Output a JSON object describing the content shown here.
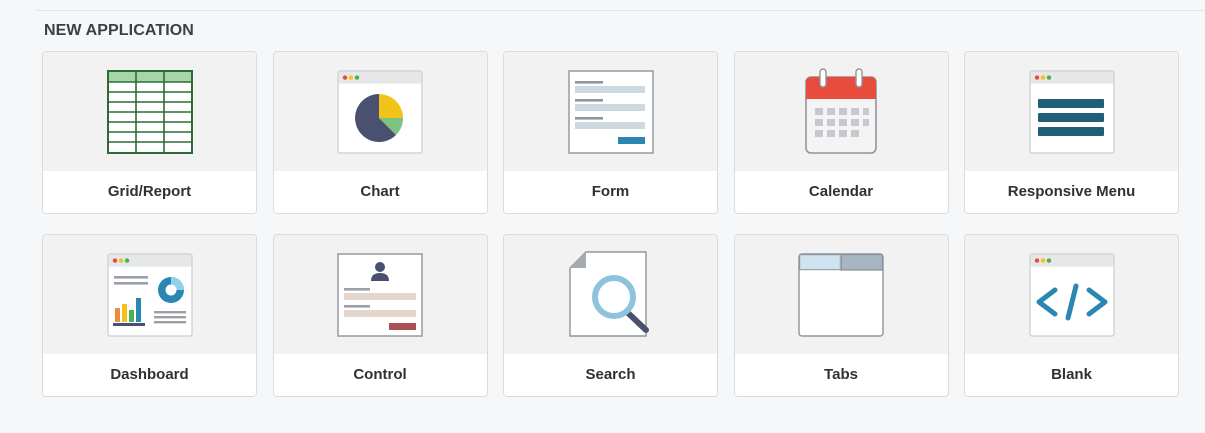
{
  "section": {
    "title": "NEW APPLICATION"
  },
  "cards": [
    {
      "label": "Grid/Report",
      "icon": "grid-report-icon"
    },
    {
      "label": "Chart",
      "icon": "chart-icon"
    },
    {
      "label": "Form",
      "icon": "form-icon"
    },
    {
      "label": "Calendar",
      "icon": "calendar-icon"
    },
    {
      "label": "Responsive Menu",
      "icon": "responsive-menu-icon"
    },
    {
      "label": "Dashboard",
      "icon": "dashboard-icon"
    },
    {
      "label": "Control",
      "icon": "control-icon"
    },
    {
      "label": "Search",
      "icon": "search-icon"
    },
    {
      "label": "Tabs",
      "icon": "tabs-icon"
    },
    {
      "label": "Blank",
      "icon": "blank-code-icon"
    }
  ],
  "colors": {
    "grid_green": "#2e7d32",
    "pie_navy": "#4a5170",
    "pie_yellow": "#f0c419",
    "pie_green": "#7bc47f",
    "calendar_red": "#e74c3c",
    "menu_teal": "#1f5f78",
    "accent_blue": "#2b86b2"
  }
}
